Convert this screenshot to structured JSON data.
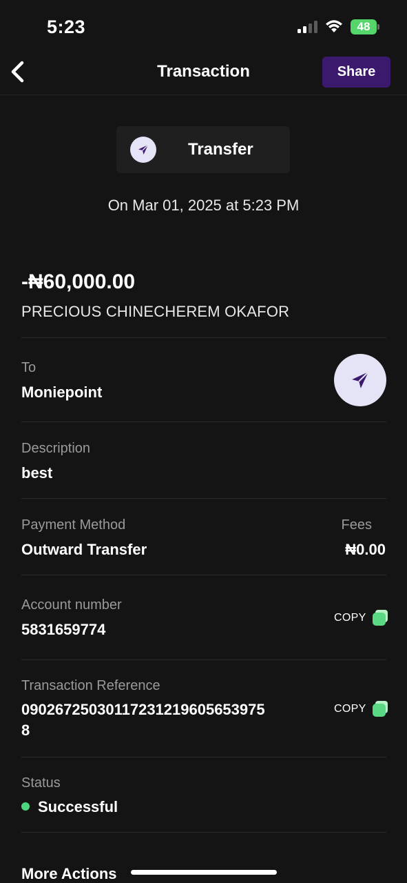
{
  "status_bar": {
    "time": "5:23",
    "battery_level": "48",
    "battery_color": "#55d66b",
    "icons": [
      "signal-icon",
      "wifi-icon",
      "battery-charging-icon"
    ]
  },
  "header": {
    "title": "Transaction",
    "share_label": "Share",
    "share_color": "#3b1a6e",
    "back_icon": "chevron-left-icon"
  },
  "transaction": {
    "type_label": "Transfer",
    "type_icon": "paper-plane-icon",
    "date": "On Mar 01, 2025 at 5:23 PM",
    "amount": "-₦60,000.00",
    "beneficiary": "PRECIOUS CHINECHEREM OKAFOR"
  },
  "details": {
    "to_label": "To",
    "to_value": "Moniepoint",
    "description_label": "Description",
    "description_value": "best",
    "payment_method_label": "Payment Method",
    "payment_method_value": "Outward Transfer",
    "fees_label": "Fees",
    "fees_value": "₦0.00",
    "account_number_label": "Account number",
    "account_number_value": "5831659774",
    "reference_label": "Transaction Reference",
    "reference_line1": "09026725030117231219605653975",
    "reference_line2": "8",
    "copy_label": "COPY",
    "status_label": "Status",
    "status_value": "Successful",
    "status_color": "#4ed67f"
  },
  "footer": {
    "more_actions": "More Actions"
  }
}
